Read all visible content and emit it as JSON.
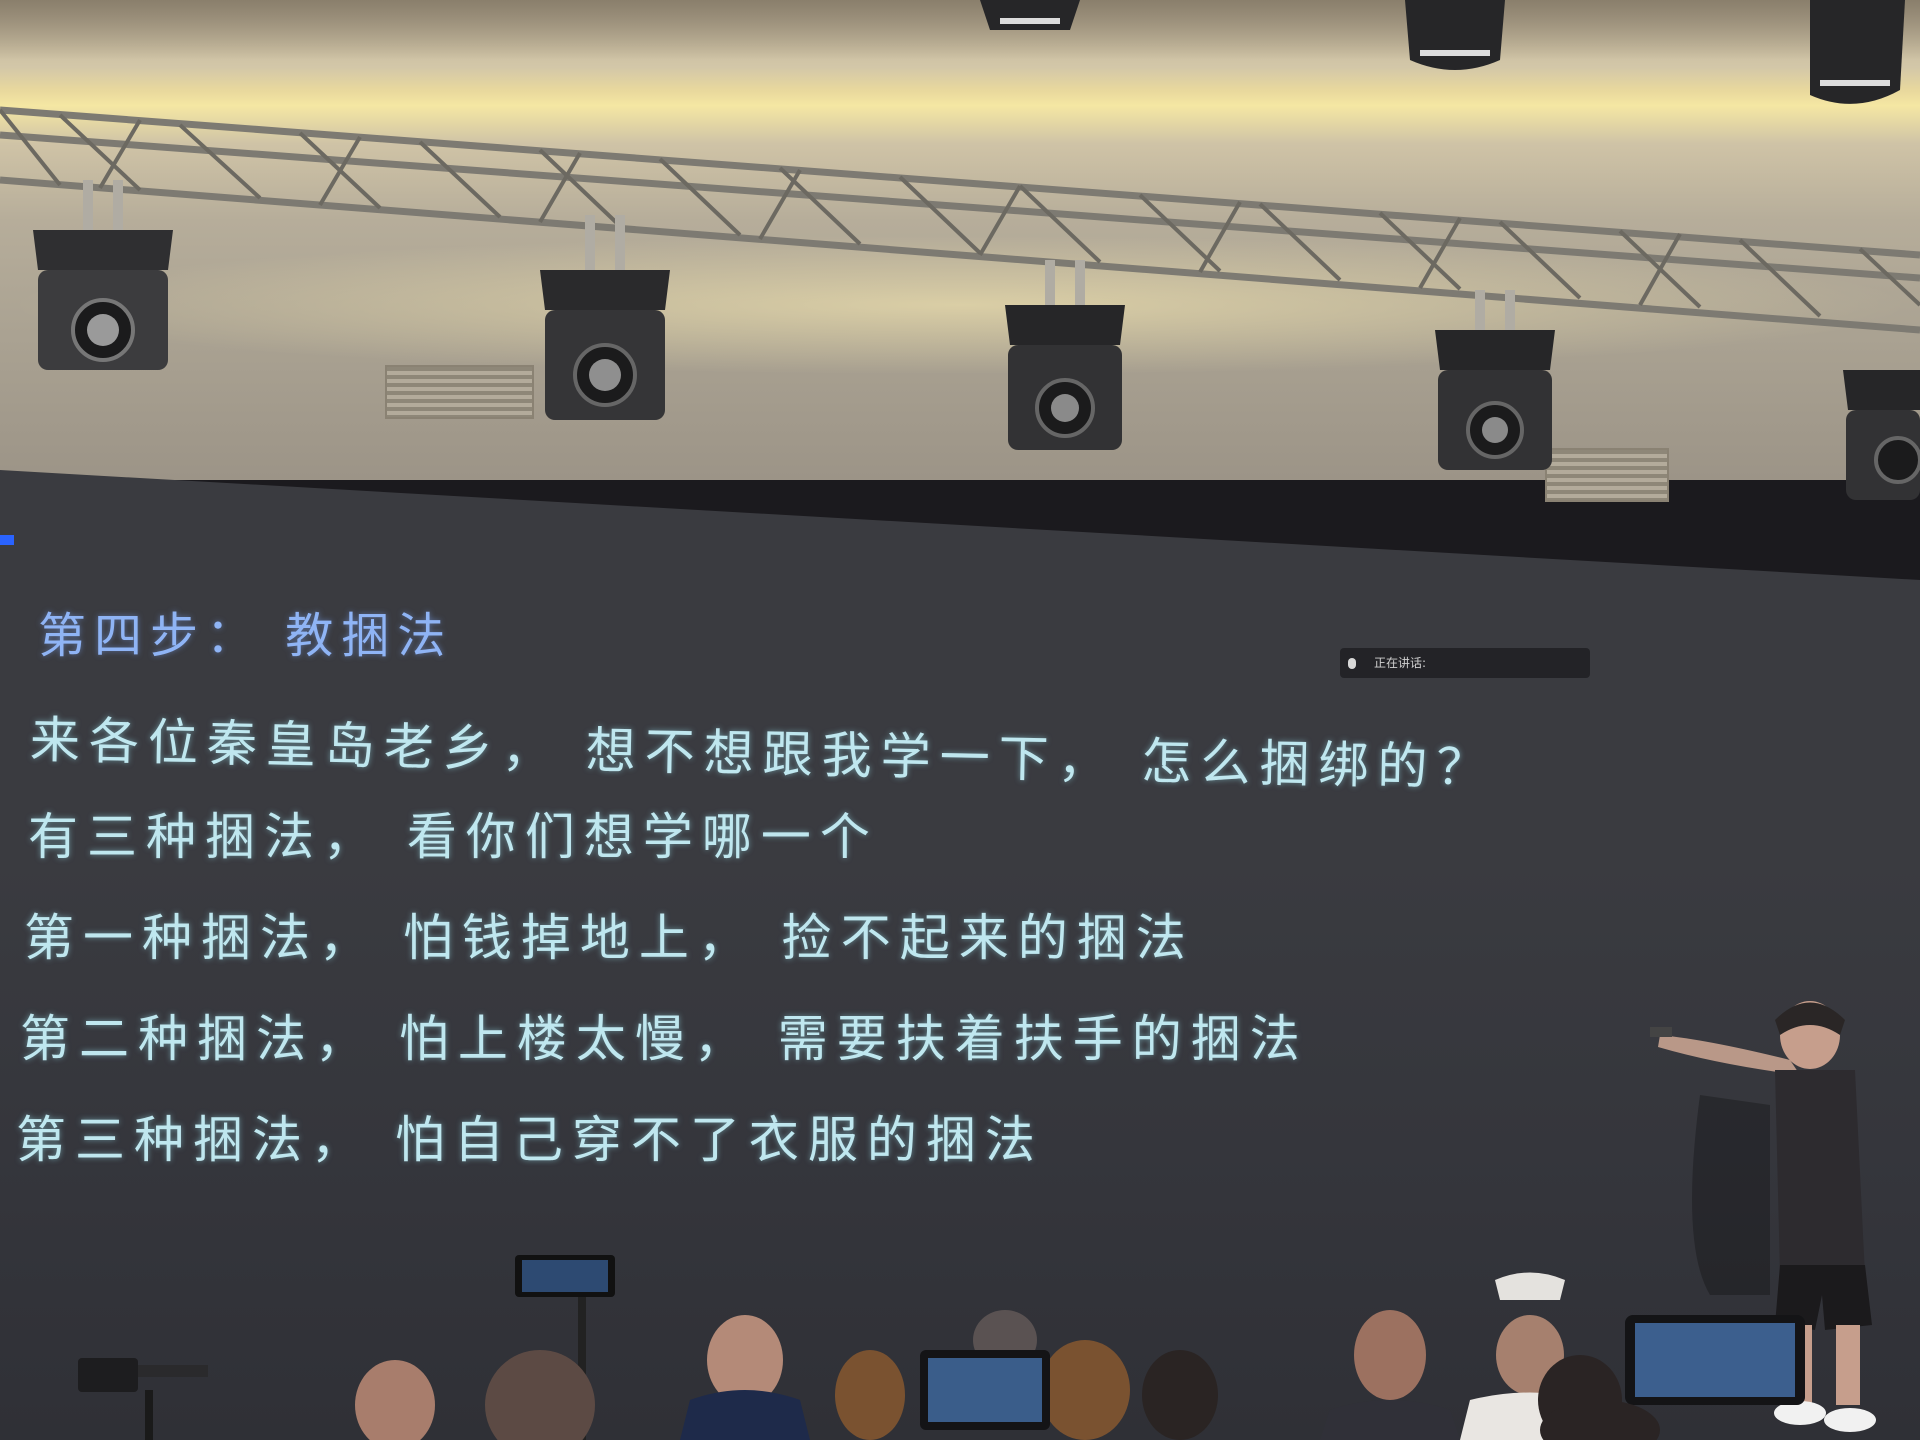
{
  "slide": {
    "title": "第四步： 教捆法",
    "lines": [
      "来各位秦皇岛老乡， 想不想跟我学一下， 怎么捆绑的？",
      "有三种捆法， 看你们想学哪一个",
      "第一种捆法， 怕钱掉地上， 捡不起来的捆法",
      "第二种捆法， 怕上楼太慢， 需要扶着扶手的捆法",
      "第三种捆法， 怕自己穿不了衣服的捆法"
    ],
    "speaking_indicator": "正在讲话:"
  },
  "colors": {
    "title_text": "#8fb4f5",
    "body_text": "#bfe7ef",
    "screen_bg": "#3a3b40",
    "ceiling_light": "#f5e7a3"
  }
}
